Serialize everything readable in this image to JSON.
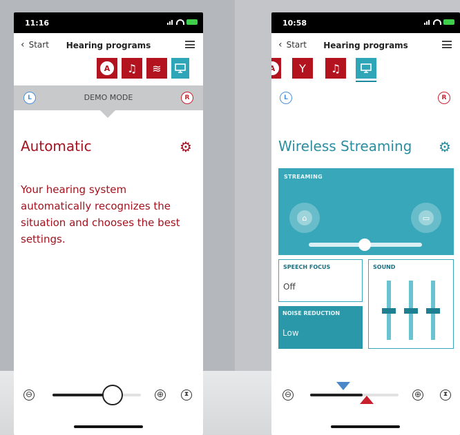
{
  "screen1": {
    "status": {
      "time": "11:16"
    },
    "nav": {
      "back_label": "Start",
      "title": "Hearing programs"
    },
    "programs": [
      "A",
      "music-note",
      "waves",
      "monitor"
    ],
    "demo_mode": "DEMO MODE",
    "side_left": "L",
    "side_right": "R",
    "program_title": "Automatic",
    "description": "Your hearing system automatically recognizes the situation and chooses the best settings.",
    "volume": {
      "minus": "⊖",
      "plus": "⊕",
      "level": 0.6
    }
  },
  "screen2": {
    "status": {
      "time": "10:58"
    },
    "nav": {
      "back_label": "Start",
      "title": "Hearing programs"
    },
    "programs": [
      "A",
      "cocktail",
      "music-note",
      "monitor"
    ],
    "side_left": "L",
    "side_right": "R",
    "program_title": "Wireless Streaming",
    "streaming": {
      "label": "STREAMING",
      "level": 0.5
    },
    "speech_focus": {
      "label": "SPEECH FOCUS",
      "value": "Off"
    },
    "noise_reduction": {
      "label": "NOISE REDUCTION",
      "value": "Low"
    },
    "sound": {
      "label": "SOUND"
    },
    "volume": {
      "minus": "⊖",
      "plus": "⊕"
    }
  },
  "colors": {
    "accent_red": "#a3121e",
    "accent_teal": "#37a7b9",
    "demo_band": "#c8c9cb"
  }
}
